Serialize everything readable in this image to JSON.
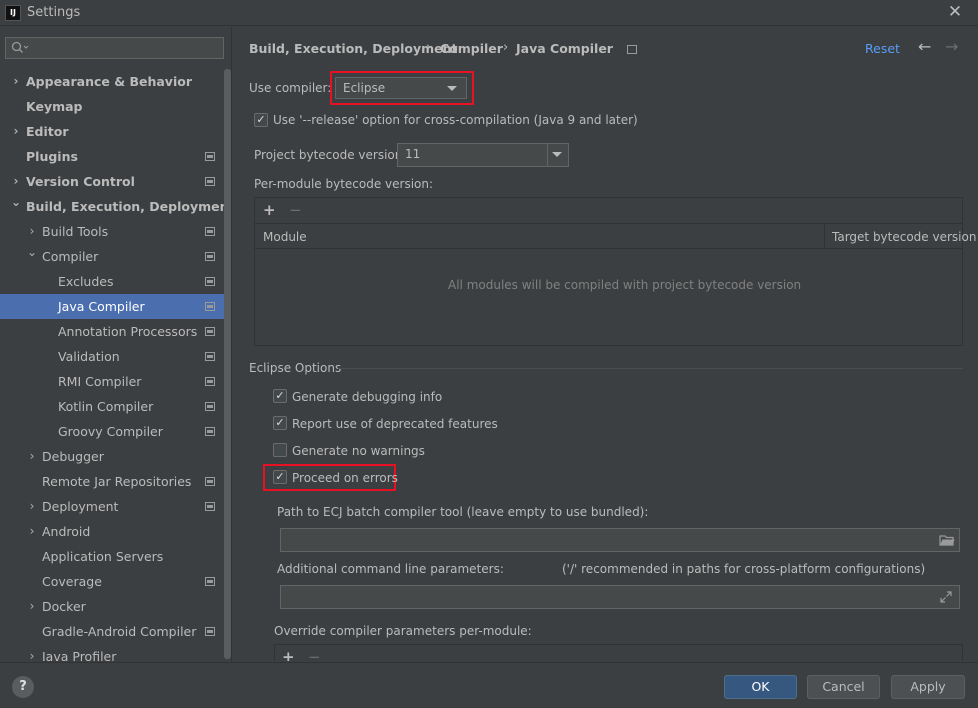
{
  "window": {
    "title": "Settings",
    "app_icon_text": "IJ"
  },
  "sidebar": {
    "items": [
      {
        "label": "Appearance & Behavior",
        "level": 0,
        "chevron": "right",
        "bold": true,
        "proj": false,
        "selected": false
      },
      {
        "label": "Keymap",
        "level": 0,
        "chevron": "",
        "bold": true,
        "proj": false,
        "selected": false
      },
      {
        "label": "Editor",
        "level": 0,
        "chevron": "right",
        "bold": true,
        "proj": false,
        "selected": false
      },
      {
        "label": "Plugins",
        "level": 0,
        "chevron": "",
        "bold": true,
        "proj": true,
        "selected": false
      },
      {
        "label": "Version Control",
        "level": 0,
        "chevron": "right",
        "bold": true,
        "proj": true,
        "selected": false
      },
      {
        "label": "Build, Execution, Deployment",
        "level": 0,
        "chevron": "down",
        "bold": true,
        "proj": false,
        "selected": false
      },
      {
        "label": "Build Tools",
        "level": 1,
        "chevron": "right",
        "bold": false,
        "proj": true,
        "selected": false
      },
      {
        "label": "Compiler",
        "level": 1,
        "chevron": "down",
        "bold": false,
        "proj": true,
        "selected": false
      },
      {
        "label": "Excludes",
        "level": 2,
        "chevron": "",
        "bold": false,
        "proj": true,
        "selected": false
      },
      {
        "label": "Java Compiler",
        "level": 2,
        "chevron": "",
        "bold": false,
        "proj": true,
        "selected": true
      },
      {
        "label": "Annotation Processors",
        "level": 2,
        "chevron": "",
        "bold": false,
        "proj": true,
        "selected": false
      },
      {
        "label": "Validation",
        "level": 2,
        "chevron": "",
        "bold": false,
        "proj": true,
        "selected": false
      },
      {
        "label": "RMI Compiler",
        "level": 2,
        "chevron": "",
        "bold": false,
        "proj": true,
        "selected": false
      },
      {
        "label": "Kotlin Compiler",
        "level": 2,
        "chevron": "",
        "bold": false,
        "proj": true,
        "selected": false
      },
      {
        "label": "Groovy Compiler",
        "level": 2,
        "chevron": "",
        "bold": false,
        "proj": true,
        "selected": false
      },
      {
        "label": "Debugger",
        "level": 1,
        "chevron": "right",
        "bold": false,
        "proj": false,
        "selected": false
      },
      {
        "label": "Remote Jar Repositories",
        "level": 1,
        "chevron": "",
        "bold": false,
        "proj": true,
        "selected": false
      },
      {
        "label": "Deployment",
        "level": 1,
        "chevron": "right",
        "bold": false,
        "proj": true,
        "selected": false
      },
      {
        "label": "Android",
        "level": 1,
        "chevron": "right",
        "bold": false,
        "proj": false,
        "selected": false
      },
      {
        "label": "Application Servers",
        "level": 1,
        "chevron": "",
        "bold": false,
        "proj": false,
        "selected": false
      },
      {
        "label": "Coverage",
        "level": 1,
        "chevron": "",
        "bold": false,
        "proj": true,
        "selected": false
      },
      {
        "label": "Docker",
        "level": 1,
        "chevron": "right",
        "bold": false,
        "proj": false,
        "selected": false
      },
      {
        "label": "Gradle-Android Compiler",
        "level": 1,
        "chevron": "",
        "bold": false,
        "proj": true,
        "selected": false
      },
      {
        "label": "Java Profiler",
        "level": 1,
        "chevron": "right",
        "bold": false,
        "proj": false,
        "selected": false
      }
    ]
  },
  "header": {
    "breadcrumb": [
      "Build, Execution, Deployment",
      "Compiler",
      "Java Compiler"
    ],
    "separator": "›",
    "reset_label": "Reset",
    "back_arrow": "←",
    "forward_arrow": "→"
  },
  "compiler": {
    "use_compiler_label": "Use compiler:",
    "use_compiler_value": "Eclipse",
    "release_option_label": "Use '--release' option for cross-compilation (Java 9 and later)",
    "release_option_checked": true,
    "bytecode_label": "Project bytecode version:",
    "bytecode_value": "11",
    "per_module_label": "Per-module bytecode version:",
    "table_columns": [
      "Module",
      "Target bytecode version"
    ],
    "table_empty_text": "All modules will be compiled with project bytecode version",
    "plus": "+",
    "minus": "−"
  },
  "eclipse": {
    "section_title": "Eclipse Options",
    "options": [
      {
        "label": "Generate debugging info",
        "checked": true
      },
      {
        "label": "Report use of deprecated features",
        "checked": true
      },
      {
        "label": "Generate no warnings",
        "checked": false
      },
      {
        "label": "Proceed on errors",
        "checked": true
      }
    ],
    "ecj_path_label": "Path to ECJ batch compiler tool (leave empty to use bundled):",
    "ecj_path_value": "",
    "cmd_params_label": "Additional command line parameters:",
    "cmd_params_hint": "('/' recommended in paths for cross-platform configurations)",
    "cmd_params_value": "",
    "override_label": "Override compiler parameters per-module:"
  },
  "buttons": {
    "help": "?",
    "ok": "OK",
    "cancel": "Cancel",
    "apply": "Apply"
  }
}
